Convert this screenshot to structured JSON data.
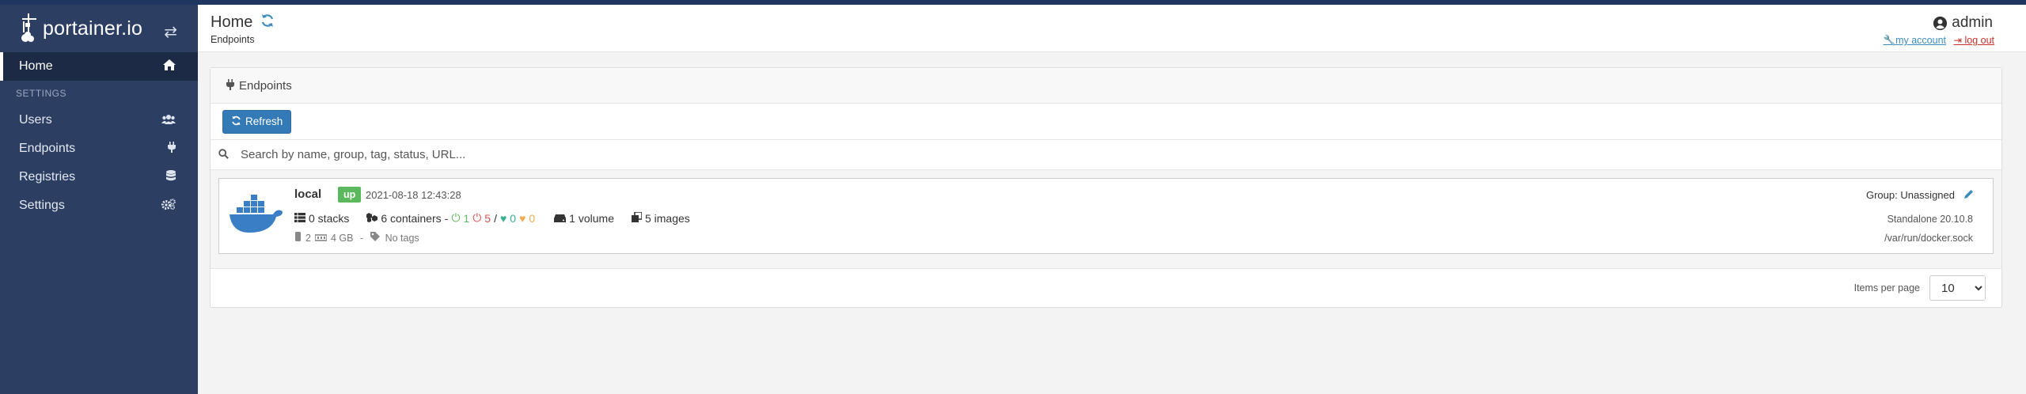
{
  "brand": {
    "name": "portainer.io"
  },
  "sidebar": {
    "items": [
      {
        "label": "Home",
        "icon": "home-icon"
      }
    ],
    "section_label": "SETTINGS",
    "settings_items": [
      {
        "label": "Users",
        "icon": "users-icon"
      },
      {
        "label": "Endpoints",
        "icon": "plug-icon"
      },
      {
        "label": "Registries",
        "icon": "database-icon"
      },
      {
        "label": "Settings",
        "icon": "cogs-icon"
      }
    ]
  },
  "header": {
    "title": "Home",
    "breadcrumb": "Endpoints",
    "user": "admin",
    "my_account": "my account",
    "log_out": "log out"
  },
  "panel": {
    "heading": "Endpoints",
    "refresh_label": "Refresh",
    "search_placeholder": "Search by name, group, tag, status, URL...",
    "items_per_page_label": "Items per page",
    "items_per_page_value": "10"
  },
  "endpoint": {
    "name": "local",
    "status": "up",
    "timestamp": "2021-08-18 12:43:28",
    "stacks": "0 stacks",
    "containers": "6 containers",
    "running": "1",
    "stopped": "5",
    "healthy": "0",
    "unhealthy": "0",
    "volumes": "1 volume",
    "images": "5 images",
    "cpus": "2",
    "memory": "4 GB",
    "tags": "No tags",
    "group": "Group: Unassigned",
    "version": "Standalone 20.10.8",
    "socket": "/var/run/docker.sock"
  },
  "colors": {
    "sidebar": "#2d3e63",
    "primary": "#337ab7",
    "status_up": "#5cb85c"
  }
}
